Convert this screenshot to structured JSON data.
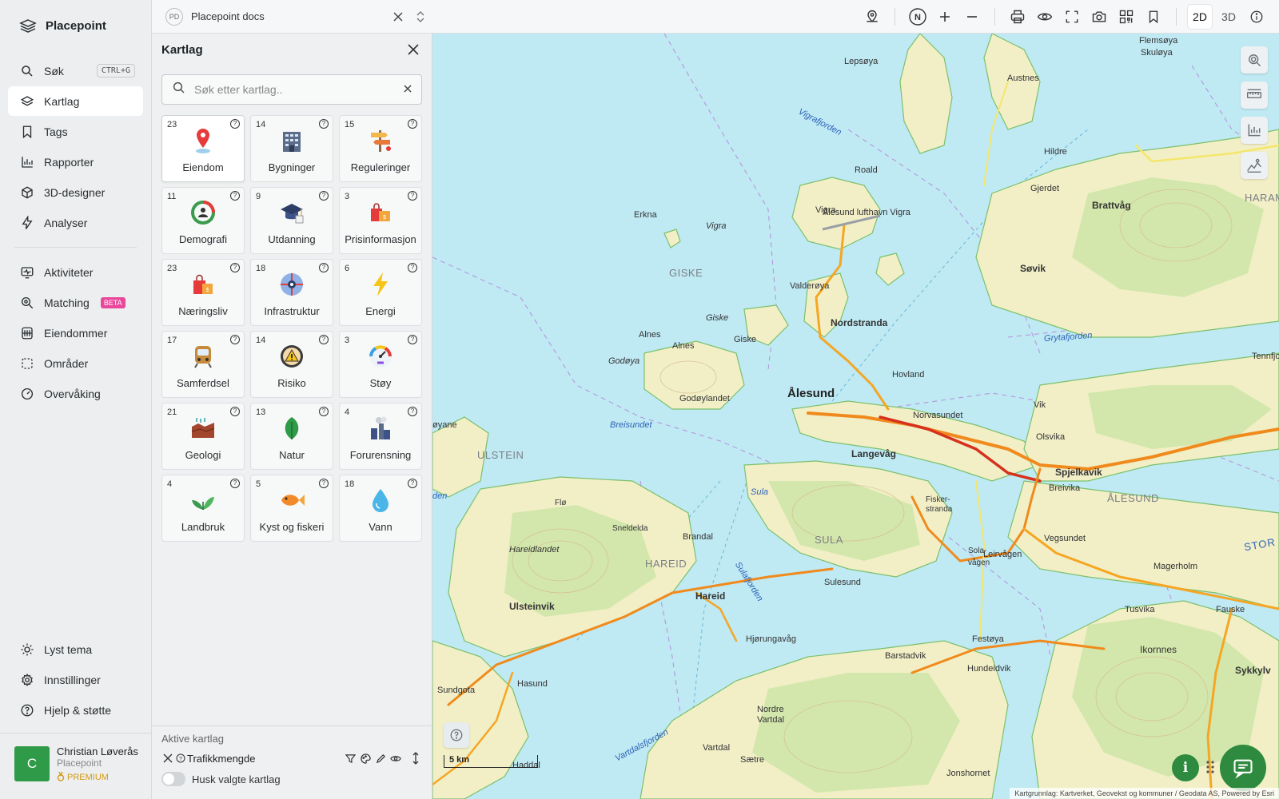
{
  "app": {
    "name": "Placepoint"
  },
  "nav": {
    "items": [
      {
        "label": "Søk",
        "shortcut": "CTRL+G"
      },
      {
        "label": "Kartlag"
      },
      {
        "label": "Tags"
      },
      {
        "label": "Rapporter"
      },
      {
        "label": "3D-designer"
      },
      {
        "label": "Analyser"
      },
      {
        "label": "Aktiviteter"
      },
      {
        "label": "Matching",
        "badge": "BETA"
      },
      {
        "label": "Eiendommer"
      },
      {
        "label": "Områder"
      },
      {
        "label": "Overvåking"
      }
    ],
    "bottom": [
      {
        "label": "Lyst tema"
      },
      {
        "label": "Innstillinger"
      },
      {
        "label": "Hjelp & støtte"
      }
    ],
    "user": {
      "initial": "C",
      "name": "Christian Løverås",
      "org": "Placepoint",
      "plan": "PREMIUM"
    }
  },
  "topbar": {
    "doc_badge": "PD",
    "doc_name": "Placepoint docs",
    "compass": "N",
    "mode_2d": "2D",
    "mode_3d": "3D"
  },
  "panel": {
    "title": "Kartlag",
    "search_placeholder": "Søk etter kartlag..",
    "tiles": [
      {
        "count": "23",
        "label": "Eiendom",
        "icon": "map-pin-icon"
      },
      {
        "count": "14",
        "label": "Bygninger",
        "icon": "building-icon"
      },
      {
        "count": "15",
        "label": "Reguleringer",
        "icon": "signpost-icon"
      },
      {
        "count": "11",
        "label": "Demografi",
        "icon": "people-ring-icon"
      },
      {
        "count": "9",
        "label": "Utdanning",
        "icon": "graduation-cap-icon"
      },
      {
        "count": "3",
        "label": "Prisinformasjon",
        "icon": "price-bags-icon"
      },
      {
        "count": "23",
        "label": "Næringsliv",
        "icon": "shopping-bag-icon"
      },
      {
        "count": "18",
        "label": "Infrastruktur",
        "icon": "infrastructure-icon"
      },
      {
        "count": "6",
        "label": "Energi",
        "icon": "lightning-icon"
      },
      {
        "count": "17",
        "label": "Samferdsel",
        "icon": "train-icon"
      },
      {
        "count": "14",
        "label": "Risiko",
        "icon": "warning-dial-icon"
      },
      {
        "count": "3",
        "label": "Støy",
        "icon": "gauge-icon"
      },
      {
        "count": "21",
        "label": "Geologi",
        "icon": "soil-layers-icon"
      },
      {
        "count": "13",
        "label": "Natur",
        "icon": "leaf-icon"
      },
      {
        "count": "4",
        "label": "Forurensning",
        "icon": "factory-icon"
      },
      {
        "count": "4",
        "label": "Landbruk",
        "icon": "sprout-icon"
      },
      {
        "count": "5",
        "label": "Kyst og fiskeri",
        "icon": "fish-icon"
      },
      {
        "count": "18",
        "label": "Vann",
        "icon": "water-drop-icon"
      }
    ],
    "active_title": "Aktive kartlag",
    "active_layers": [
      {
        "label": "Trafikkmengde"
      }
    ],
    "remember_label": "Husk valgte kartlag"
  },
  "map": {
    "labels": {
      "alesund": "Ålesund",
      "spjelkavik": "Spjelkavik",
      "nordstranda": "Nordstranda",
      "langevag": "Langevåg",
      "brattvag": "Brattvåg",
      "hovland": "Hovland",
      "norvasundet": "Norvasundet",
      "olsvika": "Olsvika",
      "breivika": "Breivika",
      "vegsundet": "Vegsundet",
      "leirvagen": "Leirvågen",
      "sula": "Sula",
      "sula_region": "SULA",
      "alesund_region": "ÅLESUND",
      "giske_region": "GISKE",
      "ulstein_region": "ULSTEIN",
      "hareid_region": "HAREID",
      "haram_region": "HARAM",
      "giske": "Giske",
      "godoya": "Godøya",
      "godoylandet": "Godøylandet",
      "alnes": "Alnes",
      "vigra": "Vigra",
      "roald": "Roald",
      "erkna": "Erkna",
      "lepsoya": "Lepsøya",
      "austnes": "Austnes",
      "flemsoya": "Flemsøya",
      "skuloya": "Skuløya",
      "hildre": "Hildre",
      "gjerdet": "Gjerdet",
      "sovik": "Søvik",
      "valderoya": "Valderøya",
      "airport": "Ålesund lufthavn Vigra",
      "hareid": "Hareid",
      "ulsteinvik": "Ulsteinvik",
      "hareidlandet": "Hareidlandet",
      "brandal": "Brandal",
      "sulesund": "Sulesund",
      "hjorungavag": "Hjørungavåg",
      "hasund": "Hasund",
      "sundgota": "Sundgota",
      "haddal": "Haddal",
      "nordre_vartdal": "Nordre Vartdal",
      "vartdal": "Vartdal",
      "saetre": "Sætre",
      "barstadvik": "Barstadvik",
      "hundeidvik": "Hundeidvik",
      "festoya": "Festøya",
      "ikornnes": "Ikornnes",
      "tusvika": "Tusvika",
      "magerholm": "Magerholm",
      "fauske": "Fauske",
      "sykkylv": "Sykkylv",
      "jonshornet": "Jonshornet",
      "vik": "Vik",
      "tennfjord": "Tennfjo",
      "fiskerstranda": "Fisker-\nstranda",
      "solavagen": "Sola-\nvågen",
      "snelderda": "Sneldelda",
      "flo": "Flø",
      "vigrafjorden": "Vigrafjorden",
      "breisundet": "Breisundet",
      "grytafjorden": "Grytafjorden",
      "sulafjorden": "Sulafjorden",
      "vartdalsfjorden": "Vartdalsfjorden",
      "storfjorden": "STOR",
      "oyane": "øyane",
      "den": "den"
    },
    "scale": "5 km",
    "attribution": "Kartgrunnlag: Kartverket, Geovekst og kommuner / Geodata AS, Powered by Esri",
    "info_icon": "i"
  }
}
